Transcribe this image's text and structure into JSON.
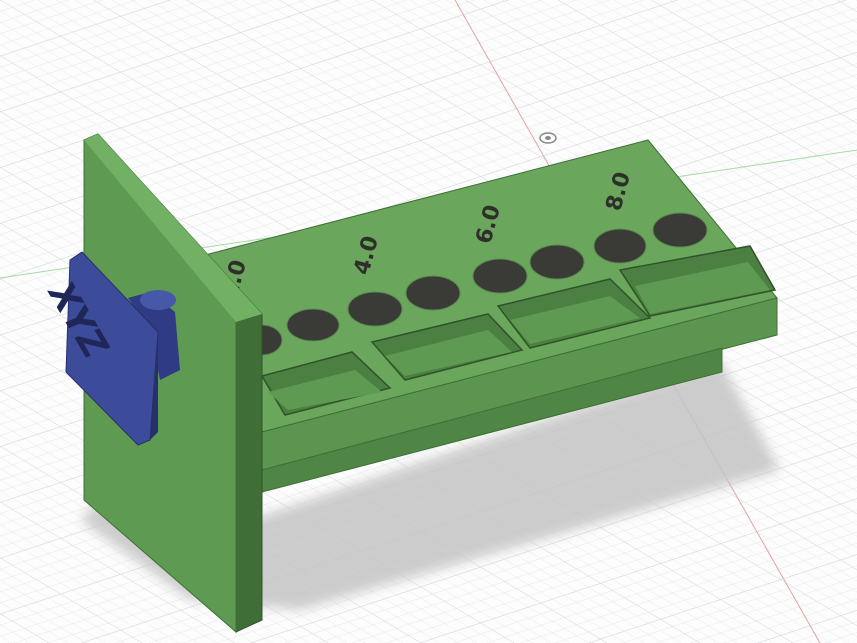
{
  "scene": {
    "background": "#fdfdfd",
    "grid_minor_color": "#e3e7ea",
    "grid_major_color": "#cdd3d8",
    "axis_red": "#e9a1a1",
    "axis_green": "#9fd59f",
    "model_green": "#5f9a52",
    "model_green_light": "#6fad60",
    "model_green_dark": "#3f6f36",
    "hole_color": "#3a3a36",
    "badge_blue": "#3c4c9a",
    "badge_blue_dark": "#26306a",
    "shadow": "#c7c7c7"
  },
  "model": {
    "badge_text": "XYZ",
    "slot_labels": [
      "2.0",
      "4.0",
      "6.0",
      "8.0"
    ],
    "origin_marker": "origin-marker"
  }
}
